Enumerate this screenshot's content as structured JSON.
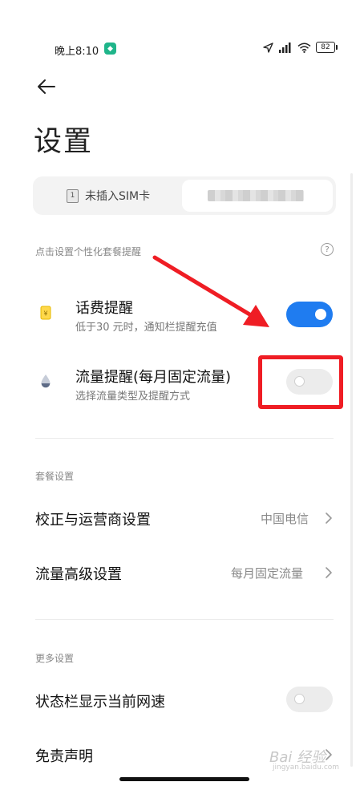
{
  "status_bar": {
    "time": "晚上8:10",
    "app_badge": "◆",
    "battery": "82"
  },
  "header": {
    "title": "设置"
  },
  "sim_tabs": {
    "tab1_chip": "1",
    "tab1_label": "未插入SIM卡"
  },
  "reminder_section": {
    "label": "点击设置个性化套餐提醒",
    "help": "?",
    "items": [
      {
        "title": "话费提醒",
        "subtitle": "低于30 元时，通知栏提醒充值",
        "toggle": true
      },
      {
        "title": "流量提醒(每月固定流量)",
        "subtitle": "选择流量类型及提醒方式",
        "toggle": false
      }
    ]
  },
  "plan_section": {
    "label": "套餐设置",
    "items": [
      {
        "title": "校正与运营商设置",
        "value": "中国电信"
      },
      {
        "title": "流量高级设置",
        "value": "每月固定流量"
      }
    ]
  },
  "more_section": {
    "label": "更多设置",
    "items": [
      {
        "title": "状态栏显示当前网速",
        "toggle": false
      },
      {
        "title": "免责声明"
      }
    ]
  },
  "watermark": {
    "text": "Bai 经验",
    "sub": "jingyan.baidu.com"
  },
  "colors": {
    "accent": "#1f7cf0",
    "highlight": "#ef1d24"
  }
}
